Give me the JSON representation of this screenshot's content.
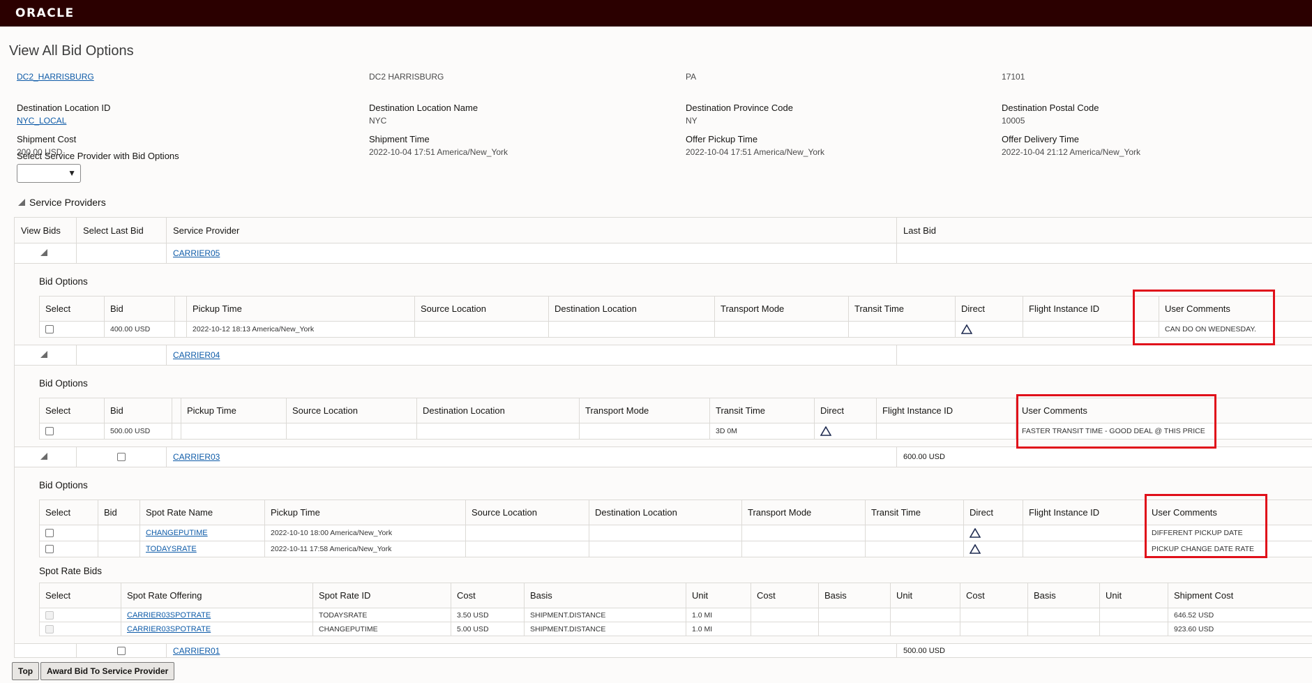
{
  "brand": {
    "logo": "ORACLE"
  },
  "page_title": "View All Bid Options",
  "info": [
    {
      "label": "",
      "value": "DC2_HARRISBURG",
      "link": true
    },
    {
      "label": "",
      "value": "DC2 HARRISBURG",
      "link": false
    },
    {
      "label": "",
      "value": "PA",
      "link": false
    },
    {
      "label": "",
      "value": "17101",
      "link": false
    },
    {
      "label": "Destination Location ID",
      "value": "NYC_LOCAL",
      "link": true
    },
    {
      "label": "Destination Location Name",
      "value": "NYC",
      "link": false
    },
    {
      "label": "Destination Province Code",
      "value": "NY",
      "link": false
    },
    {
      "label": "Destination Postal Code",
      "value": "10005",
      "link": false
    },
    {
      "label": "Shipment Cost",
      "value": "200.00 USD",
      "link": false
    },
    {
      "label": "Shipment Time",
      "value": "2022-10-04 17:51 America/New_York",
      "link": false
    },
    {
      "label": "Offer Pickup Time",
      "value": "2022-10-04 17:51 America/New_York",
      "link": false
    },
    {
      "label": "Offer Delivery Time",
      "value": "2022-10-04 21:12 America/New_York",
      "link": false
    }
  ],
  "select_provider": {
    "label": "Select Service Provider with Bid Options",
    "value": ""
  },
  "section_title": "Service Providers",
  "main_headers": {
    "view_bids": "View Bids",
    "select_last_bid": "Select Last Bid",
    "service_provider": "Service Provider",
    "last_bid": "Last Bid"
  },
  "carriers": {
    "c05": {
      "name": "CARRIER05",
      "last_bid": ""
    },
    "c04": {
      "name": "CARRIER04",
      "last_bid": ""
    },
    "c03": {
      "name": "CARRIER03",
      "last_bid": "600.00 USD"
    },
    "c01": {
      "name": "CARRIER01",
      "last_bid": "500.00 USD"
    }
  },
  "bid_options_title": "Bid Options",
  "spot_rate_bids_title": "Spot Rate Bids",
  "bid_headers": {
    "select": "Select",
    "bid": "Bid",
    "spot_rate_name": "Spot Rate Name",
    "pickup_time": "Pickup Time",
    "source_location": "Source Location",
    "destination_location": "Destination Location",
    "transport_mode": "Transport Mode",
    "transit_time": "Transit Time",
    "direct": "Direct",
    "flight_instance_id": "Flight Instance ID",
    "user_comments": "User Comments"
  },
  "c05_bids": [
    {
      "bid": "400.00 USD",
      "pickup": "2022-10-12 18:13 America/New_York",
      "transit": "",
      "comment": "CAN DO ON WEDNESDAY."
    }
  ],
  "c04_bids": [
    {
      "bid": "500.00 USD",
      "pickup": "",
      "transit": "3D 0M",
      "comment": "FASTER TRANSIT TIME - GOOD DEAL @ THIS PRICE"
    }
  ],
  "c03_bids": [
    {
      "spot": "CHANGEPUTIME",
      "pickup": "2022-10-10 18:00 America/New_York",
      "comment": "DIFFERENT PICKUP DATE"
    },
    {
      "spot": "TODAYSRATE",
      "pickup": "2022-10-11 17:58 America/New_York",
      "comment": "PICKUP CHANGE DATE RATE"
    }
  ],
  "spot_headers": {
    "select": "Select",
    "offering": "Spot Rate Offering",
    "id": "Spot Rate ID",
    "cost": "Cost",
    "basis": "Basis",
    "unit": "Unit",
    "shipment_cost": "Shipment Cost"
  },
  "spot_rows": [
    {
      "offering": "CARRIER03SPOTRATE",
      "id": "TODAYSRATE",
      "cost": "3.50 USD",
      "basis": "SHIPMENT.DISTANCE",
      "unit": "1.0 MI",
      "shipment_cost": "646.52 USD"
    },
    {
      "offering": "CARRIER03SPOTRATE",
      "id": "CHANGEPUTIME",
      "cost": "5.00 USD",
      "basis": "SHIPMENT.DISTANCE",
      "unit": "1.0 MI",
      "shipment_cost": "923.60 USD"
    }
  ],
  "buttons": {
    "top": "Top",
    "award": "Award Bid To Service Provider"
  },
  "colors": {
    "topbar": "#2b0000",
    "link": "#0e5ba8",
    "highlight": "#e0101a"
  }
}
